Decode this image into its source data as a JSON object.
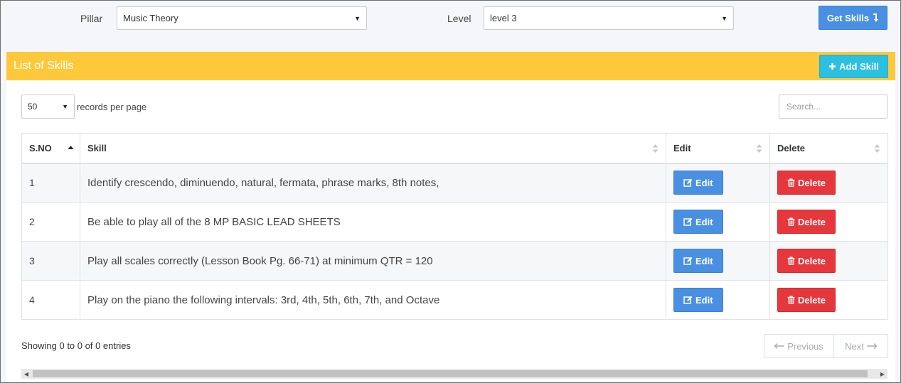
{
  "filters": {
    "pillar_label": "Pillar",
    "pillar_value": "Music Theory",
    "level_label": "Level",
    "level_value": "level 3",
    "get_skills_label": "Get Skills"
  },
  "panel": {
    "title": "List of Skills",
    "add_skill_label": "Add Skill"
  },
  "table_controls": {
    "records_value": "50",
    "records_label": "records per page",
    "search_placeholder": "Search..."
  },
  "table": {
    "columns": [
      "S.NO",
      "Skill",
      "Edit",
      "Delete"
    ],
    "rows": [
      {
        "sno": "1",
        "skill": "Identify crescendo, diminuendo, natural, fermata, phrase marks, 8th notes,"
      },
      {
        "sno": "2",
        "skill": "Be able to play all of the 8 MP BASIC LEAD SHEETS"
      },
      {
        "sno": "3",
        "skill": "Play all scales correctly (Lesson Book Pg. 66-71) at minimum QTR = 120"
      },
      {
        "sno": "4",
        "skill": "Play on the piano the following intervals: 3rd, 4th, 5th, 6th, 7th, and Octave"
      }
    ],
    "edit_label": "Edit",
    "delete_label": "Delete"
  },
  "footer": {
    "info": "Showing 0 to 0 of 0 entries",
    "previous_label": "Previous",
    "next_label": "Next"
  },
  "colors": {
    "header": "#fdc93b",
    "primary": "#4a90e2",
    "info": "#2cc0e0",
    "danger": "#e6373d"
  }
}
